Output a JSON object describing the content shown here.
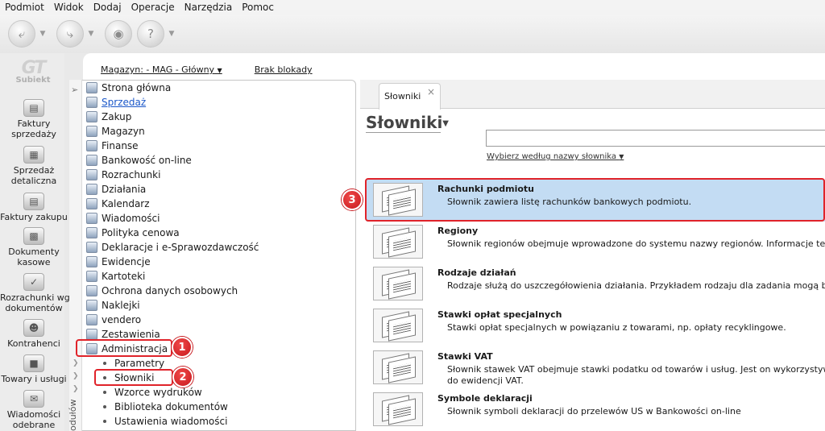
{
  "menu": [
    "Podmiot",
    "Widok",
    "Dodaj",
    "Operacje",
    "Narzędzia",
    "Pomoc"
  ],
  "logo": {
    "mark": "GT",
    "label": "Subiekt"
  },
  "modules": [
    {
      "label": "Faktury\nsprzedaży",
      "icon": "invoice-stack-icon"
    },
    {
      "label": "Sprzedaż\ndetaliczna",
      "icon": "cash-register-icon"
    },
    {
      "label": "Faktury zakupu",
      "icon": "purchase-invoice-icon"
    },
    {
      "label": "Dokumenty\nkasowe",
      "icon": "cash-documents-icon"
    },
    {
      "label": "Rozrachunki wg\ndokumentów",
      "icon": "settlements-icon"
    },
    {
      "label": "Kontrahenci",
      "icon": "contractor-icon"
    },
    {
      "label": "Towary i usługi",
      "icon": "goods-icon"
    },
    {
      "label": "Wiadomości\nodebrane",
      "icon": "messages-icon"
    }
  ],
  "header": {
    "warehouse": "Magazyn: - MAG - Główny",
    "lock": "Brak blokady"
  },
  "nav": {
    "side_label": "odułów",
    "items": [
      "Strona główna",
      "Sprzedaż",
      "Zakup",
      "Magazyn",
      "Finanse",
      "Bankowość on-line",
      "Rozrachunki",
      "Działania",
      "Kalendarz",
      "Wiadomości",
      "Polityka cenowa",
      "Deklaracje i e-Sprawozdawczość",
      "Ewidencje",
      "Kartoteki",
      "Ochrona danych osobowych",
      "Naklejki",
      "vendero",
      "Zestawienia",
      "Administracja"
    ],
    "sub_items": [
      "Parametry",
      "Słowniki",
      "Wzorce wydruków",
      "Biblioteka dokumentów",
      "Ustawienia wiadomości"
    ]
  },
  "badges": [
    "1",
    "2",
    "3"
  ],
  "tab": {
    "label": "Słowniki",
    "close": "×"
  },
  "page": {
    "title": "Słowniki",
    "search_hint": "Wybierz według nazwy słownika"
  },
  "dictionaries": [
    {
      "title": "Rachunki podmiotu",
      "desc": "Słownik zawiera listę rachunków bankowych podmiotu."
    },
    {
      "title": "Regiony",
      "desc": "Słownik regionów obejmuje wprowadzone do systemu nazwy regionów. Informacje te są w"
    },
    {
      "title": "Rodzaje działań",
      "desc": "Rodzaje służą do uszczegółowienia działania. Przykładem rodzaju dla zadania mogą być: \"Za"
    },
    {
      "title": "Stawki opłat specjalnych",
      "desc": "Stawki opłat specjalnych w powiązaniu z towarami, np. opłaty recyklingowe."
    },
    {
      "title": "Stawki VAT",
      "desc": "Słownik stawek VAT obejmuje stawki podatku od towarów i usług. Jest on wykorzystywany\ndo ewidencji VAT."
    },
    {
      "title": "Symbole deklaracji",
      "desc": "Słownik symboli deklaracji do przelewów US w Bankowości on-line"
    }
  ]
}
